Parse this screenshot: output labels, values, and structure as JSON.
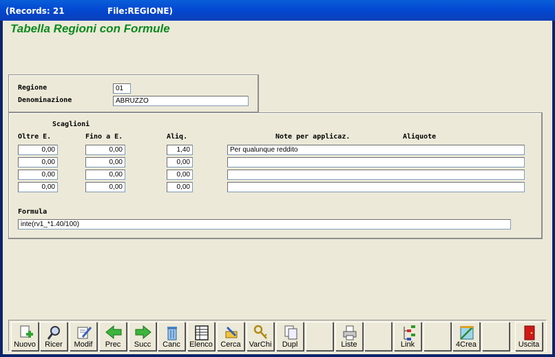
{
  "window": {
    "records": "(Records: 21",
    "file": "File:REGIONE)"
  },
  "page": {
    "title": "Tabella Regioni con Formule"
  },
  "regione": {
    "regione_label": "Regione",
    "regione_value": "01",
    "denominazione_label": "Denominazione",
    "denominazione_value": "ABRUZZO"
  },
  "scaglioni": {
    "header": "Scaglioni",
    "col_oltre": "Oltre E.",
    "col_fino": "Fino a E.",
    "col_aliq": "Aliq.",
    "col_note": "Note per applicaz.",
    "col_aliquote": "Aliquote",
    "rows": [
      {
        "oltre": "0,00",
        "fino": "0,00",
        "aliq": "1,40",
        "note": "Per qualunque reddito"
      },
      {
        "oltre": "0,00",
        "fino": "0,00",
        "aliq": "0,00",
        "note": ""
      },
      {
        "oltre": "0,00",
        "fino": "0,00",
        "aliq": "0,00",
        "note": ""
      },
      {
        "oltre": "0,00",
        "fino": "0,00",
        "aliq": "0,00",
        "note": ""
      }
    ]
  },
  "formula": {
    "label": "Formula",
    "value": "inte(rv1_*1.40/100)"
  },
  "toolbar": {
    "buttons": [
      {
        "label": "Nuovo",
        "icon": "new-record-icon"
      },
      {
        "label": "Ricer",
        "icon": "search-icon"
      },
      {
        "label": "Modif",
        "icon": "edit-icon"
      },
      {
        "label": "Prec",
        "icon": "arrow-left-icon"
      },
      {
        "label": "Succ",
        "icon": "arrow-right-icon"
      },
      {
        "label": "Canc",
        "icon": "trash-icon"
      },
      {
        "label": "Elenco",
        "icon": "list-icon"
      },
      {
        "label": "Cerca",
        "icon": "find-icon"
      },
      {
        "label": "VarChi",
        "icon": "keys-icon"
      },
      {
        "label": "Dupl",
        "icon": "duplicate-icon"
      },
      {
        "label": "",
        "icon": ""
      },
      {
        "label": "Liste",
        "icon": "printer-icon"
      },
      {
        "label": "",
        "icon": ""
      },
      {
        "label": "Link",
        "icon": "link-tree-icon"
      },
      {
        "label": "",
        "icon": ""
      },
      {
        "label": "4Crea",
        "icon": "create-icon"
      },
      {
        "label": "",
        "icon": ""
      },
      {
        "label": "Uscita",
        "icon": "exit-door-icon"
      }
    ]
  },
  "colors": {
    "title_green": "#0a8a1e",
    "titlebar_blue": "#0349d3",
    "face": "#ece9d8"
  }
}
